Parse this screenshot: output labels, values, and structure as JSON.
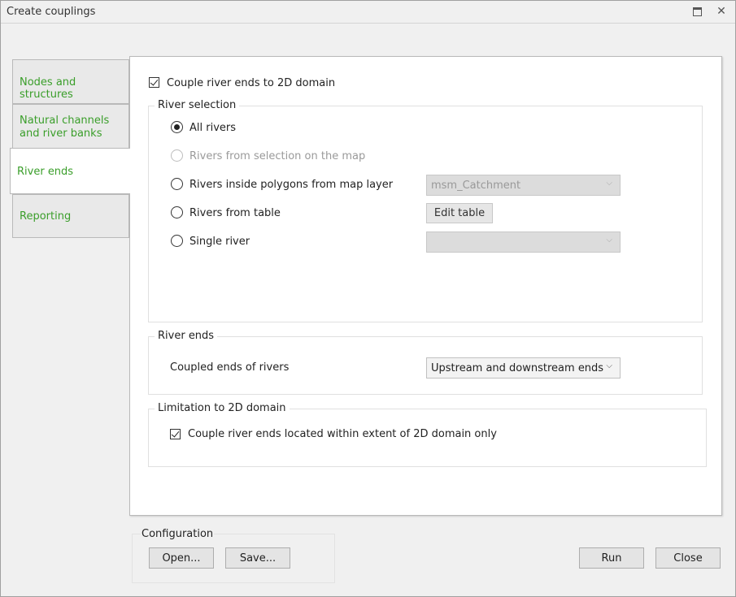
{
  "window": {
    "title": "Create couplings"
  },
  "tabs": [
    {
      "label": "Nodes and structures"
    },
    {
      "label_line1": "Natural channels",
      "label_line2": "and river banks"
    },
    {
      "label": "River ends",
      "active": true
    },
    {
      "label": "Reporting"
    }
  ],
  "panel": {
    "couple_checkbox": {
      "label": "Couple river ends to 2D domain",
      "checked": true
    },
    "river_selection": {
      "title": "River selection",
      "options": [
        {
          "label": "All rivers",
          "selected": true,
          "enabled": true
        },
        {
          "label": "Rivers from selection on the map",
          "selected": false,
          "enabled": false
        },
        {
          "label": "Rivers inside polygons from map layer",
          "selected": false,
          "enabled": true
        },
        {
          "label": "Rivers from table",
          "selected": false,
          "enabled": true
        },
        {
          "label": "Single river",
          "selected": false,
          "enabled": true
        }
      ],
      "map_layer_combo": {
        "value": "msm_Catchment"
      },
      "edit_table_button": "Edit table",
      "single_river_combo": {
        "value": ""
      }
    },
    "river_ends": {
      "title": "River ends",
      "coupled_label": "Coupled ends of rivers",
      "coupled_combo": {
        "value": "Upstream and downstream ends"
      }
    },
    "limitation": {
      "title": "Limitation to 2D domain",
      "checkbox_label": "Couple river ends located within extent of 2D domain only",
      "checked": true
    }
  },
  "configuration": {
    "title": "Configuration",
    "open_button": "Open...",
    "save_button": "Save..."
  },
  "footer": {
    "run_button": "Run",
    "close_button": "Close"
  },
  "colors": {
    "tab_text": "#3a9e2a",
    "window_bg": "#f0f0f0",
    "panel_bg": "#ffffff"
  }
}
